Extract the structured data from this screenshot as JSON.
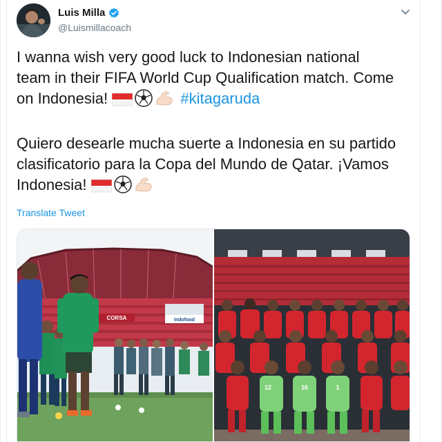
{
  "author": {
    "display_name": "Luis Milla",
    "handle": "@Luismillacoach",
    "verified": true
  },
  "tweet": {
    "line_en_1": "I wanna wish very good luck to Indonesian national",
    "line_en_2": "team in their FIFA World Cup Qualification match. Come",
    "line_en_3": "on Indonesia!",
    "hashtag": "#kitagaruda",
    "line_es_1": "Quiero desearle mucha suerte a Indonesia en su partido",
    "line_es_2": "clasificatorio para la Copa del Mundo de Qatar. ¡Vamos",
    "line_es_3": "Indonesia!",
    "emojis": [
      "indonesia-flag",
      "soccer-ball",
      "flexed-biceps"
    ]
  },
  "translate_label": "Translate Tweet",
  "media": {
    "count": 2,
    "left_photo_signs": [
      "CORSA",
      "Indofood"
    ],
    "left_photo_subject": "training-session",
    "right_photo_subject": "team-photo"
  },
  "colors": {
    "accent": "#1b95e0",
    "text": "#14171a",
    "muted": "#657786",
    "verified": "#1da1f2"
  }
}
